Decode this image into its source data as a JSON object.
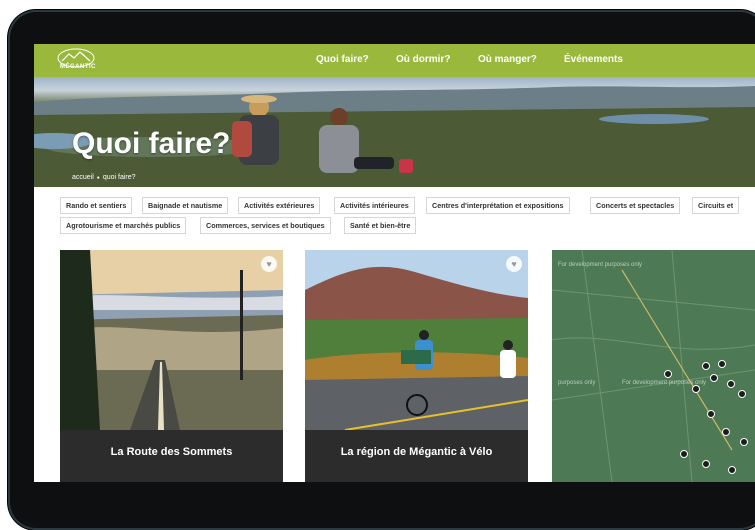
{
  "brand": {
    "logo_text": "MÉGANTIC"
  },
  "nav": {
    "items": [
      "Quoi faire?",
      "Où dormir?",
      "Où manger?",
      "Événements"
    ]
  },
  "hero": {
    "title": "Quoi faire?",
    "breadcrumb": [
      "accueil",
      "●",
      "quoi faire?"
    ]
  },
  "filters": {
    "row1": [
      "Rando et sentiers",
      "Baignade et nautisme",
      "Activités extérieures",
      "Activités intérieures",
      "Centres d'interprétation et expositions",
      "Concerts et spectacles",
      "Circuits et"
    ],
    "row2": [
      "Agrotourisme et marchés publics",
      "Commerces, services et boutiques",
      "Santé et bien-être"
    ]
  },
  "cards": [
    {
      "title": "La Route des Sommets"
    },
    {
      "title": "La région de Mégantic à Vélo"
    }
  ],
  "map": {
    "watermark": "For development purposes only",
    "watermark_short": "purposes only"
  },
  "colors": {
    "nav_green": "#9ab93c",
    "tablet": "#0d0f10",
    "card_bg": "#2c2c2c",
    "map_green": "#4d7a54"
  }
}
